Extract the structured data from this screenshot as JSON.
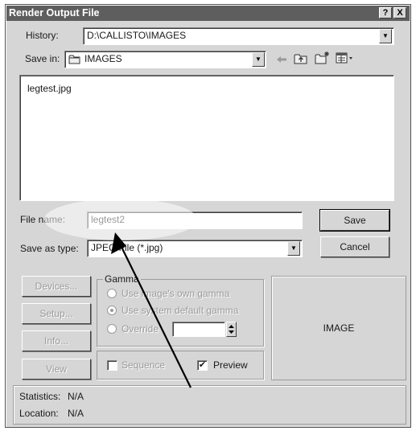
{
  "window": {
    "title": "Render Output File",
    "help_glyph": "?",
    "close_glyph": "X"
  },
  "history": {
    "label": "History:",
    "value": "D:\\CALLISTO\\IMAGES"
  },
  "save_in": {
    "label": "Save in:",
    "value": "IMAGES",
    "folder_icon": "folder-icon",
    "toolbar_icons": [
      "back-arrow-icon",
      "up-folder-icon",
      "new-folder-icon",
      "view-menu-icon"
    ]
  },
  "file_list": {
    "items": [
      "legtest.jpg"
    ]
  },
  "file_name": {
    "label": "File name:",
    "value": "legtest2"
  },
  "save_as_type": {
    "label": "Save as type:",
    "value": "JPEG File (*.jpg)"
  },
  "buttons": {
    "save": "Save",
    "cancel": "Cancel",
    "devices": "Devices...",
    "setup": "Setup...",
    "info": "Info...",
    "view": "View"
  },
  "gamma": {
    "title": "Gamma",
    "options": [
      "Use image's own gamma",
      "Use system default gamma",
      "Override"
    ],
    "selected": 1,
    "override_value": ""
  },
  "options": {
    "sequence_label": "Sequence",
    "sequence_checked": false,
    "preview_label": "Preview",
    "preview_checked": true
  },
  "preview_area": {
    "text": "IMAGE"
  },
  "status": {
    "statistics_label": "Statistics:",
    "statistics_value": "N/A",
    "location_label": "Location:",
    "location_value": "N/A"
  }
}
